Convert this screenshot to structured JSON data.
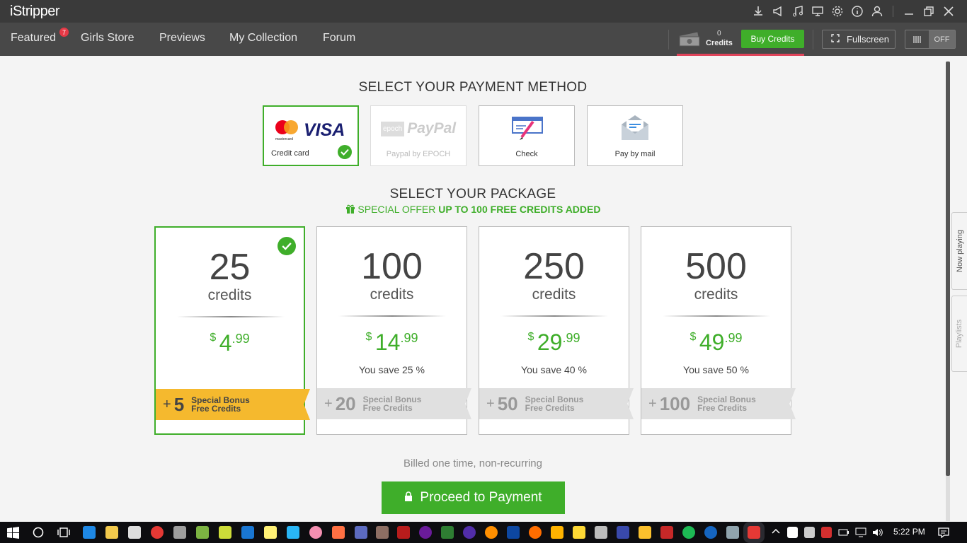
{
  "app": {
    "title": "iStripper"
  },
  "nav": {
    "items": [
      "Featured",
      "Girls Store",
      "Previews",
      "My Collection",
      "Forum"
    ],
    "featured_badge": "7",
    "credits_count": "0",
    "credits_label": "Credits",
    "buy_label": "Buy Credits",
    "fullscreen_label": "Fullscreen",
    "toggle_label": "OFF"
  },
  "payment": {
    "heading": "SELECT YOUR PAYMENT METHOD",
    "methods": [
      {
        "label": "Credit card",
        "selected": true,
        "logo_text": "VISA",
        "logo_sub": "mastercard"
      },
      {
        "label": "Paypal by EPOCH",
        "disabled": true,
        "logo_text": "PayPal",
        "logo_sub": "epoch"
      },
      {
        "label": "Check"
      },
      {
        "label": "Pay by mail"
      }
    ]
  },
  "package": {
    "heading": "SELECT YOUR PACKAGE",
    "special_prefix": "SPECIAL OFFER",
    "special_bold": "UP TO 100 FREE CREDITS ADDED",
    "credits_word": "credits",
    "bonus_line1": "Special Bonus",
    "bonus_line2": "Free Credits",
    "items": [
      {
        "credits": "25",
        "currency": "$",
        "price_int": "4",
        "price_dec": ".99",
        "save": "",
        "bonus": "5",
        "selected": true
      },
      {
        "credits": "100",
        "currency": "$",
        "price_int": "14",
        "price_dec": ".99",
        "save": "You save 25 %",
        "bonus": "20"
      },
      {
        "credits": "250",
        "currency": "$",
        "price_int": "29",
        "price_dec": ".99",
        "save": "You save 40 %",
        "bonus": "50"
      },
      {
        "credits": "500",
        "currency": "$",
        "price_int": "49",
        "price_dec": ".99",
        "save": "You save 50 %",
        "bonus": "100"
      }
    ]
  },
  "billing": {
    "note": "Billed one time, non-recurring",
    "proceed_label": "Proceed to Payment"
  },
  "side_tabs": {
    "now_playing": "Now playing",
    "playlists": "Playlists"
  },
  "taskbar": {
    "time": "5:22 PM"
  },
  "colors": {
    "accent": "#3fae2a",
    "ribbon": "#f5b92e",
    "header": "#3a3a3a",
    "nav": "#484848"
  }
}
